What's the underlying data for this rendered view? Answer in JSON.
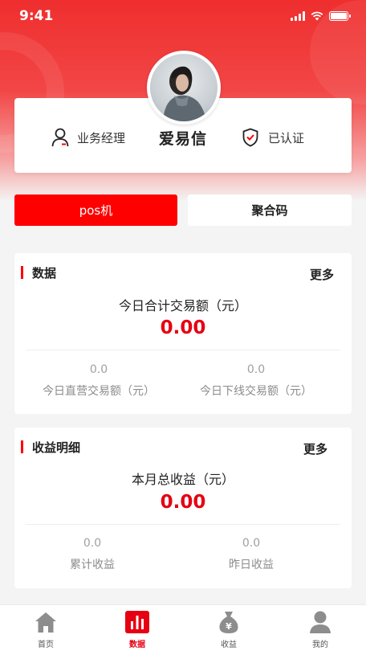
{
  "status": {
    "time": "9:41"
  },
  "profile": {
    "role": "业务经理",
    "name": "爱易信",
    "verified": "已认证"
  },
  "tabs": {
    "pos": "pos机",
    "qr": "聚合码"
  },
  "data_card": {
    "title": "数据",
    "more": "更多",
    "main_label": "今日合计交易额（元）",
    "main_value": "0.00",
    "left_value": "0.0",
    "left_label": "今日直营交易额（元）",
    "right_value": "0.0",
    "right_label": "今日下线交易额（元）"
  },
  "income_card": {
    "title": "收益明细",
    "more": "更多",
    "main_label": "本月总收益（元）",
    "main_value": "0.00",
    "left_value": "0.0",
    "left_label": "累计收益",
    "right_value": "0.0",
    "right_label": "昨日收益"
  },
  "tabbar": {
    "items": [
      {
        "label": "首页",
        "icon": "home-icon"
      },
      {
        "label": "数据",
        "icon": "bar-chart-icon",
        "active": true
      },
      {
        "label": "收益",
        "icon": "money-bag-icon"
      },
      {
        "label": "我的",
        "icon": "user-icon"
      }
    ]
  },
  "colors": {
    "accent": "#fe0000",
    "value_red": "#e60012",
    "hero_red": "#ef2e2e"
  }
}
